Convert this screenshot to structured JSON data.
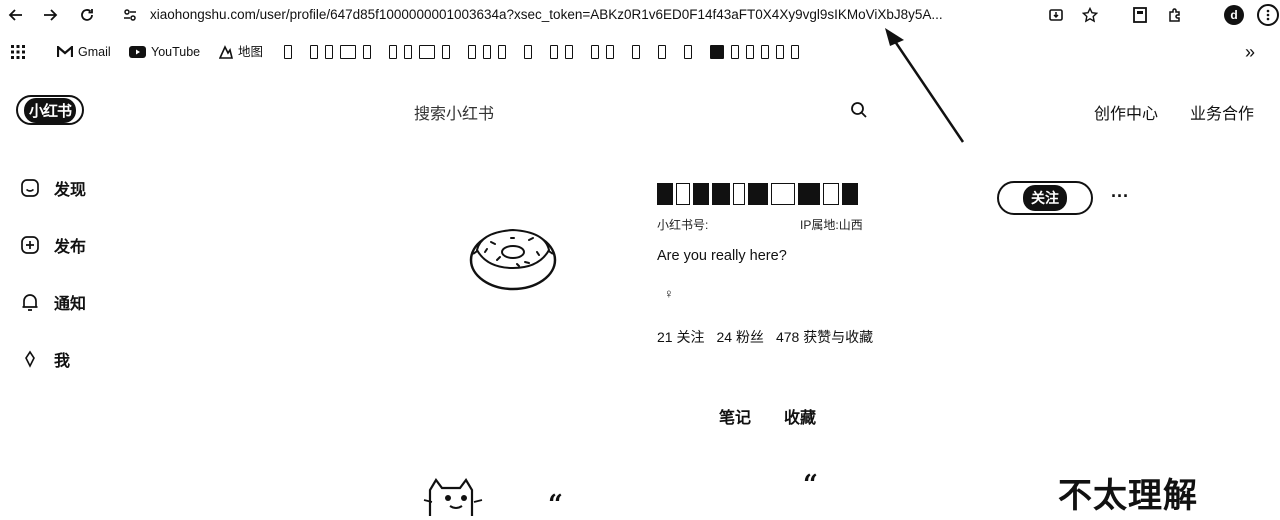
{
  "browser": {
    "url": "xiaohongshu.com/user/profile/647d85f1000000001003634a?xsec_token=ABKz0R1v6ED0F14f43aFT0X4Xy9vgl9sIKMoViXbJ8y5A...",
    "profile_initial": "d",
    "bookmarks": [
      {
        "label": "Gmail",
        "icon": "gmail-icon"
      },
      {
        "label": "YouTube",
        "icon": "youtube-icon"
      },
      {
        "label": "地图",
        "icon": "maps-icon"
      }
    ],
    "more_bookmarks": "»"
  },
  "site": {
    "logo": "小红书",
    "search_placeholder": "搜索小红书",
    "nav": [
      "创作中心",
      "业务合作"
    ]
  },
  "sidebar": {
    "items": [
      {
        "label": "发现",
        "icon": "home-icon"
      },
      {
        "label": "发布",
        "icon": "plus-square-icon"
      },
      {
        "label": "通知",
        "icon": "bell-icon"
      },
      {
        "label": "我",
        "icon": "avatar-icon"
      }
    ]
  },
  "profile": {
    "id_label": "小红书号:",
    "ip_label": "IP属地:",
    "ip_value": "山西",
    "bio": "Are you really here?",
    "gender_symbol": "♀",
    "stats": [
      {
        "value": "21",
        "label": "关注"
      },
      {
        "value": "24",
        "label": "粉丝"
      },
      {
        "value": "478",
        "label": "获赞与收藏"
      }
    ],
    "follow_label": "关注",
    "more_label": "···"
  },
  "tabs": [
    "笔记",
    "收藏"
  ],
  "feed": {
    "quote1": "“",
    "quote2": "“",
    "caption": "不太理解"
  }
}
